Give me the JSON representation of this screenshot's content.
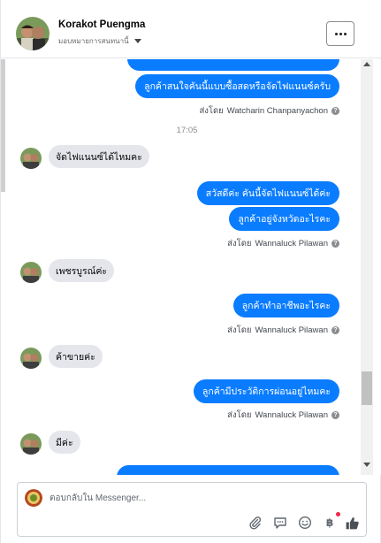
{
  "header": {
    "contact_name": "Korakot Puengma",
    "assign_label": "มอบหมายการสนทนานี้",
    "more_label": "..."
  },
  "conversation": {
    "time_separator": "17:05",
    "messages": [
      {
        "direction": "out",
        "text": "ลูกค้าสนใจคันนี้แบบซื้อสดหรือจัดไฟแนนซ์ครับ"
      },
      {
        "direction": "in",
        "text": "จัดไฟแนนซ์ได้ไหมคะ"
      },
      {
        "direction": "out",
        "text": "สวัสดีค่ะ คันนี้จัดไฟแนนซ์ได้ค่ะ"
      },
      {
        "direction": "out",
        "text": "ลูกค้าอยู่จังหวัดอะไรคะ"
      },
      {
        "direction": "in",
        "text": "เพชรบูรณ์ค่ะ"
      },
      {
        "direction": "out",
        "text": "ลูกค้าทำอาชีพอะไรคะ"
      },
      {
        "direction": "in",
        "text": "ค้าขายค่ะ"
      },
      {
        "direction": "out",
        "text": "ลูกค้ามีประวัติการผ่อนอยู่ไหมคะ"
      },
      {
        "direction": "in",
        "text": "มีค่ะ"
      }
    ],
    "sent_by": [
      {
        "label": "ส่งโดย",
        "name": "Watcharin Chanpanyachon"
      },
      {
        "label": "ส่งโดย",
        "name": "Wannaluck Pilawan"
      },
      {
        "label": "ส่งโดย",
        "name": "Wannaluck Pilawan"
      },
      {
        "label": "ส่งโดย",
        "name": "Wannaluck Pilawan"
      }
    ],
    "help_icon": "question-circle-icon"
  },
  "composer": {
    "placeholder": "ตอบกลับใน Messenger...",
    "tools": [
      "paperclip-icon",
      "message-bubble-icon",
      "smiley-icon",
      "baht-icon",
      "thumbs-up-icon"
    ],
    "baht_symbol": "฿"
  },
  "colors": {
    "outgoing_bubble": "#0a7cff",
    "incoming_bubble": "#e4e6eb",
    "like": "#4b4f56",
    "notification_dot": "#f02849"
  }
}
